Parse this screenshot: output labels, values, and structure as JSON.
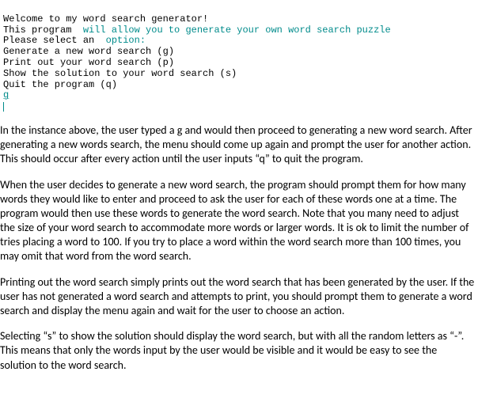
{
  "console": {
    "line1": "Welcome to my word search generator!",
    "line2_a": "This program ",
    "line2_b": " will allow you to generate your own word search puzzle",
    "line3_a": "Please select an ",
    "line3_b": " option:",
    "line4": "Generate a new word search (g)",
    "line5": "Print out your word search (p)",
    "line6": "Show the solution to your word search (s)",
    "line7": "Quit the program (q)",
    "input": "g"
  },
  "paragraphs": {
    "p1": "In the instance above, the user typed a g and would then proceed to generating a new word search. After generating a new words search, the menu should come up again and prompt the user for another action. This should occur after every action until the user inputs “q” to quit the program.",
    "p2": "When the user decides to generate a new word search, the program should prompt them for how many words they would like to enter and proceed to ask the user for each of these words one at a time. The program would then use these words to generate the word search. Note that you many need to adjust the size of your word search to accommodate more words or larger words. It is ok to limit the number of tries placing a word to 100. If you try to place a word within the word search more than 100 times, you may omit that word from the word search.",
    "p3": "Printing out the word search simply prints out the word search that has been generated by the user. If the user has not generated a word search and attempts to print, you should prompt them to generate a word search and display the menu again and wait for the user to choose an action.",
    "p4": "Selecting “s” to show the solution should display the word search, but with all the random letters as “-”. This means that only the words input by the user would be visible and it would be easy to see the solution to the word search."
  }
}
